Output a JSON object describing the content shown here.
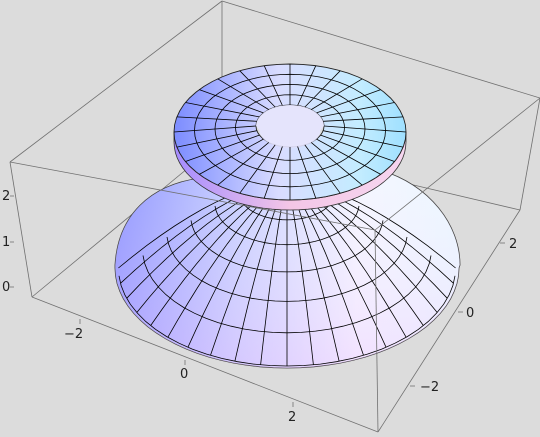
{
  "chart_data": {
    "type": "surface3d",
    "title": "",
    "xlabel": "",
    "ylabel": "",
    "zlabel": "",
    "x_ticks": [
      "−2",
      "0",
      "2"
    ],
    "y_ticks": [
      "2",
      "0",
      "−2"
    ],
    "z_ticks": [
      "2",
      "1",
      "0"
    ],
    "xlim": [
      -3.3,
      3.3
    ],
    "ylim": [
      -3.3,
      3.3
    ],
    "zlim": [
      -0.1,
      2.6
    ],
    "box": true,
    "surfaces": [
      {
        "name": "",
        "shape": "dome",
        "r_range": [
          0,
          3
        ],
        "z_base": 0,
        "z_top": 1.85
      },
      {
        "name": "",
        "shape": "annular-disc",
        "r_range": [
          0.8,
          2.6
        ],
        "z_bottom": 1.72,
        "z_top": 2.05
      }
    ],
    "colors": {
      "surface_light": "#f6f2ff",
      "surface_blue": "#7f8cff",
      "surface_cyan": "#a9e6ff",
      "surface_pink": "#f2c4f2",
      "mesh": "#000000",
      "box": "#707070"
    }
  }
}
